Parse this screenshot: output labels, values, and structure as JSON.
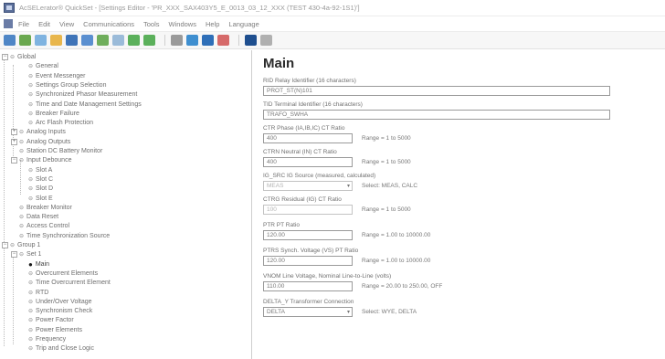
{
  "window": {
    "title": "AcSELerator® QuickSet - [Settings Editor - 'PR_XXX_SAX403Y5_E_0013_03_12_XXX (TEST 430-4a-92-1S1)']"
  },
  "menu": [
    "File",
    "Edit",
    "View",
    "Communications",
    "Tools",
    "Windows",
    "Help",
    "Language"
  ],
  "toolbar_colors": [
    "#4f86c6",
    "#6aa84f",
    "#7fb3e0",
    "#e8b64c",
    "#3f74b8",
    "#5a8fd0",
    "#6fae5c",
    "#9bbbd9",
    "#5bb05b",
    "#5bb05b",
    "#9a9a9a",
    "#3f8fd0",
    "#2f6fb8",
    "#d66a6a",
    "#1f4f8f",
    "#b0b0b0",
    "#b0b0b0",
    "#b0b0b0"
  ],
  "tree": {
    "nodes": [
      {
        "label": "Global",
        "expander": "−",
        "icon": "⊖"
      },
      {
        "label": "General",
        "icon": "⊖"
      },
      {
        "label": "Event Messenger",
        "icon": "⊖"
      },
      {
        "label": "Settings Group Selection",
        "icon": "⊖"
      },
      {
        "label": "Synchronized Phasor Measurement",
        "icon": "⊖"
      },
      {
        "label": "Time and Date Management Settings",
        "icon": "⊖"
      },
      {
        "label": "Breaker Failure",
        "icon": "⊖"
      },
      {
        "label": "Arc Flash Protection",
        "icon": "⊖"
      },
      {
        "label": "Analog Inputs",
        "expander": "+",
        "icon": "⊖"
      },
      {
        "label": "Analog Outputs",
        "expander": "+",
        "icon": "⊖"
      },
      {
        "label": "Station DC Battery Monitor",
        "icon": "⊖"
      },
      {
        "label": "Input Debounce",
        "expander": "−",
        "icon": "⊖"
      },
      {
        "label": "Slot A",
        "icon": "⊖"
      },
      {
        "label": "Slot C",
        "icon": "⊖"
      },
      {
        "label": "Slot D",
        "icon": "⊖"
      },
      {
        "label": "Slot E",
        "icon": "⊖"
      },
      {
        "label": "Breaker Monitor",
        "icon": "⊖"
      },
      {
        "label": "Data Reset",
        "icon": "⊖"
      },
      {
        "label": "Access Control",
        "icon": "⊖"
      },
      {
        "label": "Time Synchronization Source",
        "icon": "⊖"
      },
      {
        "label": "Group 1",
        "expander": "−",
        "icon": "⊖"
      },
      {
        "label": "Set 1",
        "expander": "−",
        "icon": "⊖"
      },
      {
        "label": "Main",
        "icon": "●",
        "selected": true
      },
      {
        "label": "Overcurrent Elements",
        "icon": "⊖"
      },
      {
        "label": "Time Overcurrent Element",
        "icon": "⊖"
      },
      {
        "label": "RTD",
        "icon": "⊖"
      },
      {
        "label": "Under/Over Voltage",
        "icon": "⊖"
      },
      {
        "label": "Synchronism Check",
        "icon": "⊖"
      },
      {
        "label": "Power Factor",
        "icon": "⊖"
      },
      {
        "label": "Power Elements",
        "icon": "⊖"
      },
      {
        "label": "Frequency",
        "icon": "⊖"
      },
      {
        "label": "Trip and Close Logic",
        "icon": "⊖"
      }
    ]
  },
  "main": {
    "title": "Main",
    "fields": [
      {
        "label": "RID  Relay Identifier (16 characters)",
        "value": "PROT_ST(N)101",
        "width": 380
      },
      {
        "label": "TID  Terminal Identifier (16 characters)",
        "value": "TRAFO_SWHA",
        "width": 380
      },
      {
        "label": "CTR  Phase (IA,IB,IC) CT Ratio",
        "value": "400",
        "width": 98,
        "range": "Range = 1 to 5000"
      },
      {
        "label": "CTRN  Neutral (IN) CT Ratio",
        "value": "400",
        "width": 98,
        "range": "Range = 1 to 5000"
      },
      {
        "label": "IG_SRC  IG Source (measured, calculated)",
        "value": "MEAS",
        "width": 98,
        "range": "Select: MEAS, CALC",
        "select": true,
        "disabled": true
      },
      {
        "label": "CTRG  Residual (IG) CT Ratio",
        "value": "100",
        "width": 98,
        "range": "Range = 1 to 5000",
        "disabled": true
      },
      {
        "label": "PTR  PT Ratio",
        "value": "120.00",
        "width": 98,
        "range": "Range = 1.00 to 10000.00"
      },
      {
        "label": "PTRS  Synch. Voltage (VS) PT Ratio",
        "value": "120.00",
        "width": 98,
        "range": "Range = 1.00 to 10000.00"
      },
      {
        "label": "VNOM  Line Voltage, Nominal Line-to-Line (volts)",
        "value": "110.00",
        "width": 98,
        "range": "Range = 20.00 to 250.00, OFF"
      },
      {
        "label": "DELTA_Y  Transformer Connection",
        "value": "DELTA",
        "width": 98,
        "range": "Select: WYE, DELTA",
        "select": true
      }
    ]
  }
}
